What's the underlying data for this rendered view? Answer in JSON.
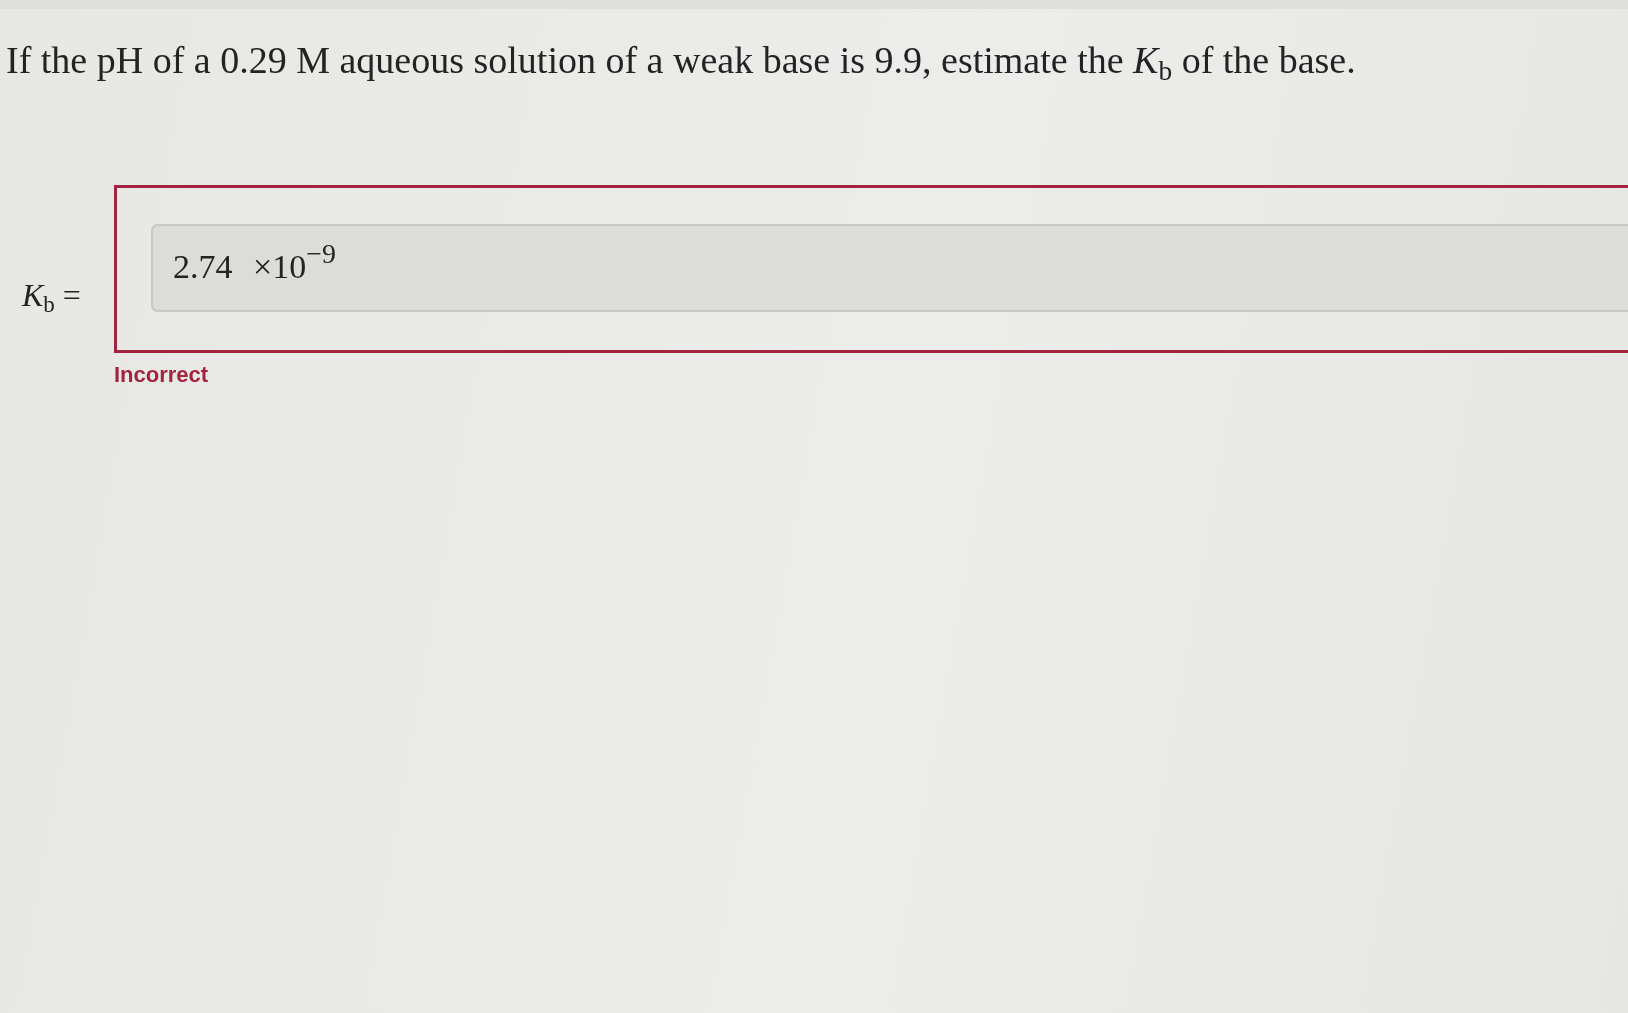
{
  "question": {
    "text": "If the pH of a 0.29 M aqueous solution of a weak base is 9.9, estimate the *K*$_{b}$ of the base."
  },
  "answer": {
    "label": "*K*$_{b}$ =",
    "value": "2.74 ×10$^{−9}$",
    "correct": false,
    "feedback": "Incorrect"
  }
}
